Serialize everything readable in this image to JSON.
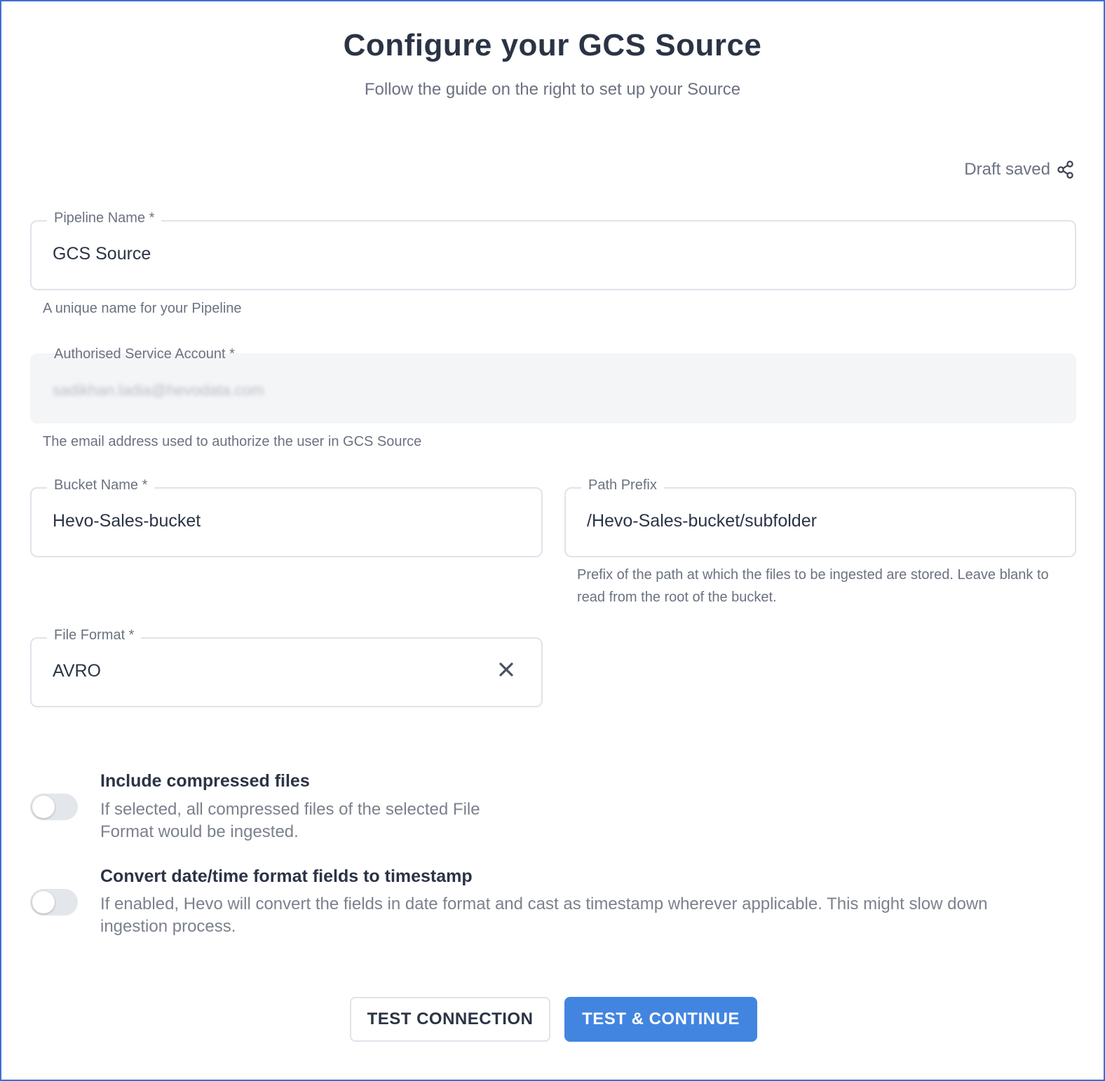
{
  "header": {
    "title": "Configure your GCS Source",
    "subtitle": "Follow the guide on the right to set up your Source"
  },
  "status": {
    "draft_label": "Draft saved",
    "share_icon": "share-icon"
  },
  "form": {
    "pipeline_name": {
      "label": "Pipeline Name *",
      "value": "GCS Source",
      "hint": "A unique name for your Pipeline"
    },
    "service_account": {
      "label": "Authorised Service Account *",
      "value": "sadikhan.ladia@hevodata.com",
      "hint": "The email address used to authorize the user in GCS Source"
    },
    "bucket_name": {
      "label": "Bucket Name *",
      "value": "Hevo-Sales-bucket"
    },
    "path_prefix": {
      "label": "Path Prefix",
      "value": "/Hevo-Sales-bucket/subfolder",
      "hint": "Prefix of the path at which the files to be ingested are stored. Leave blank to read from the root of the bucket."
    },
    "file_format": {
      "label": "File Format *",
      "value": "AVRO",
      "clear_icon": "close-icon"
    }
  },
  "options": {
    "compressed": {
      "title": "Include compressed files",
      "description": "If selected, all compressed files of the selected File Format would be ingested.",
      "enabled": false
    },
    "timestamp": {
      "title": "Convert date/time format fields to timestamp",
      "description": "If enabled, Hevo will convert the fields in date format and cast as timestamp wherever applicable. This might slow down ingestion process.",
      "enabled": false
    }
  },
  "actions": {
    "test_connection": "TEST CONNECTION",
    "test_continue": "TEST & CONTINUE"
  },
  "colors": {
    "primary": "#4285e0",
    "frame_border": "#3f6fd1",
    "text": "#2b3445",
    "muted": "#6b7280"
  }
}
